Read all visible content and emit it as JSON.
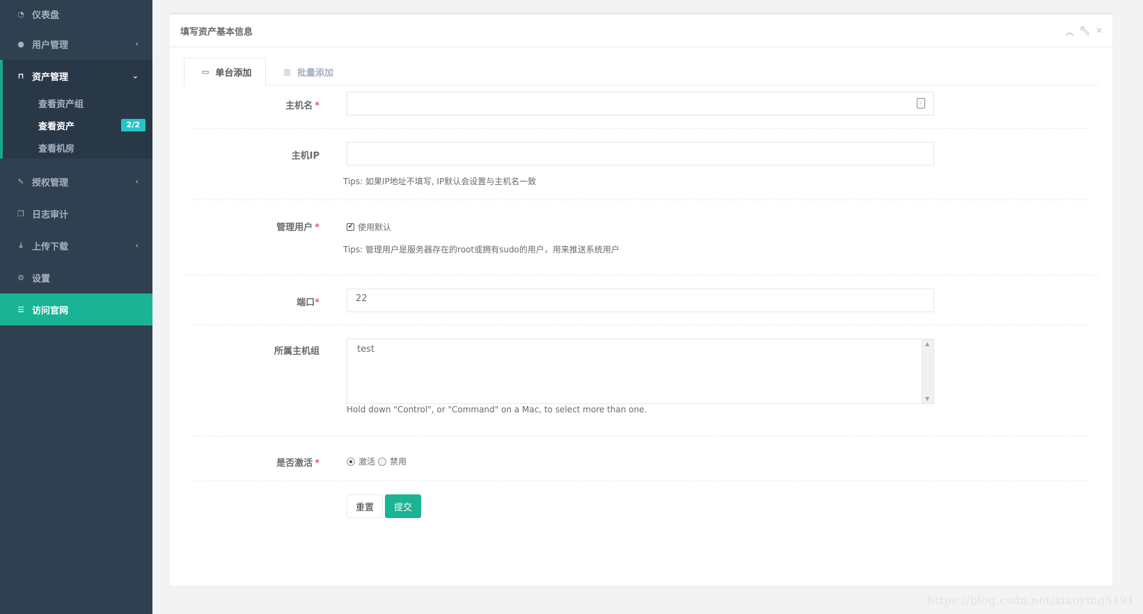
{
  "sidebar": {
    "items": [
      {
        "label": "仪表盘",
        "icon": "dashboard-icon"
      },
      {
        "label": "用户管理",
        "icon": "users-icon"
      },
      {
        "label": "资产管理",
        "icon": "inbox-icon"
      },
      {
        "label": "授权管理",
        "icon": "edit-icon"
      },
      {
        "label": "日志审计",
        "icon": "copy-icon"
      },
      {
        "label": "上传下载",
        "icon": "download-icon"
      },
      {
        "label": "设置",
        "icon": "gears-icon"
      },
      {
        "label": "访问官网",
        "icon": "database-icon"
      }
    ],
    "sub_items": [
      {
        "label": "查看资产组"
      },
      {
        "label": "查看资产",
        "badge": "2/2"
      },
      {
        "label": "查看机房"
      }
    ]
  },
  "panel": {
    "title": "填写资产基本信息"
  },
  "tabs": [
    {
      "label": "单台添加",
      "icon": "laptop-icon",
      "active": true
    },
    {
      "label": "批量添加",
      "icon": "bar-chart-icon",
      "active": false
    }
  ],
  "form": {
    "hostname": {
      "label": "主机名",
      "required": "*",
      "value": ""
    },
    "ip": {
      "label": "主机IP",
      "value": "",
      "tips": "Tips: 如果IP地址不填写, IP默认会设置与主机名一致"
    },
    "admin_user": {
      "label": "管理用户",
      "required": "*",
      "checkbox_label": "使用默认",
      "checked": true,
      "tips": "Tips: 管理用户是服务器存在的root或拥有sudo的用户，用来推送系统用户"
    },
    "port": {
      "label": "端口",
      "required": "*",
      "value": "22"
    },
    "group": {
      "label": "所属主机组",
      "options": [
        "test"
      ],
      "help": "Hold down \"Control\", or \"Command\" on a Mac, to select more than one."
    },
    "active": {
      "label": "是否激活",
      "required": "*",
      "options": [
        {
          "label": "激活",
          "selected": true
        },
        {
          "label": "禁用",
          "selected": false
        }
      ]
    }
  },
  "buttons": {
    "reset": "重置",
    "submit": "提交"
  },
  "watermark": "https://blog.csdn.net/xiaoying5191",
  "colors": {
    "sidebar_bg": "#2f4050",
    "accent": "#1ab394",
    "badge": "#23c6c8",
    "required": "#ed5565"
  }
}
